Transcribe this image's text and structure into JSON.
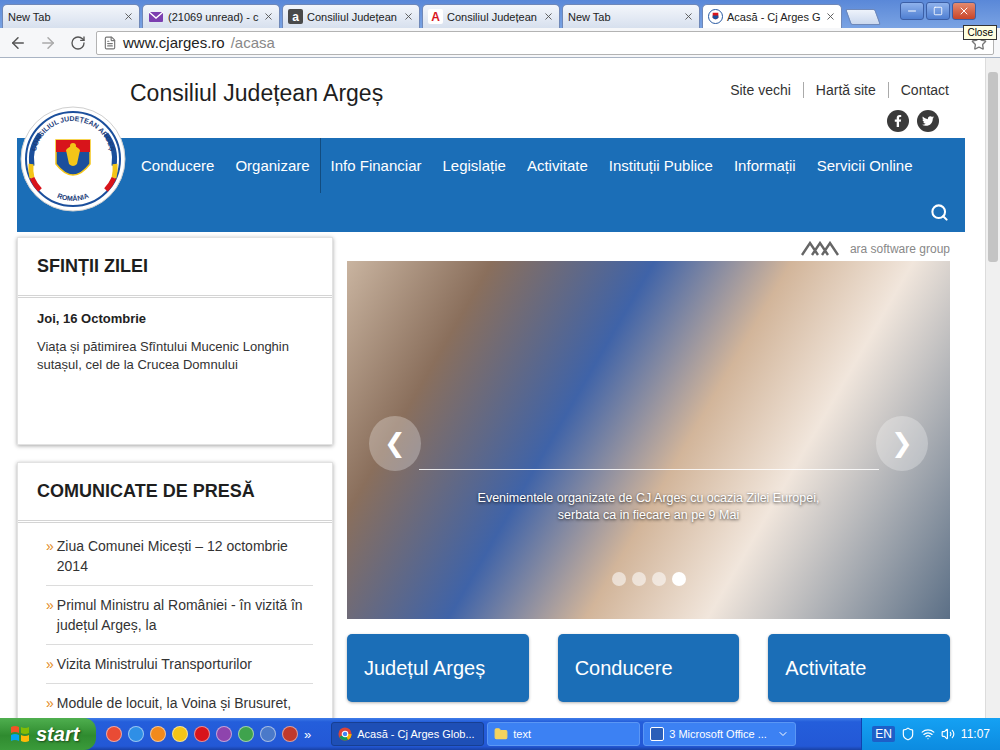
{
  "browser": {
    "tabs": [
      {
        "label": "New Tab",
        "selected": false,
        "icon": "none"
      },
      {
        "label": "(21069 unread) - c",
        "selected": false,
        "icon": "mail"
      },
      {
        "label": "Consiliul Județean",
        "selected": false,
        "icon": "letter",
        "icon_text": "a"
      },
      {
        "label": "Consiliul Județean",
        "selected": false,
        "icon": "letter-red",
        "icon_text": "A"
      },
      {
        "label": "New Tab",
        "selected": false,
        "icon": "none"
      },
      {
        "label": "Acasă - Cj Arges G",
        "selected": true,
        "icon": "crest"
      }
    ],
    "tooltip": "Close",
    "address": {
      "host": "www.cjarges.ro",
      "path": "/acasa"
    }
  },
  "site": {
    "logo": {
      "arc_top": "CONSILIUL JUDEȚEAN ARGEȘ",
      "arc_bottom": "ROMÂNIA"
    },
    "title": "Consiliul Județean Argeș",
    "top_links": [
      "Site vechi",
      "Hartă site",
      "Contact"
    ],
    "nav": [
      {
        "label": "Conducere",
        "separator_before": false
      },
      {
        "label": "Organizare",
        "separator_before": false
      },
      {
        "label": "Info Financiar",
        "separator_before": true
      },
      {
        "label": "Legislație",
        "separator_before": false
      },
      {
        "label": "Activitate",
        "separator_before": false
      },
      {
        "label": "Instituții Publice",
        "separator_before": false
      },
      {
        "label": "Informații",
        "separator_before": false
      },
      {
        "label": "Servicii Online",
        "separator_before": false
      }
    ],
    "saints": {
      "heading": "SFINȚII ZILEI",
      "date": "Joi, 16 Octombrie",
      "text": "Viața și pătimirea Sfîntului Mucenic Longhin sutașul, cel de la Crucea Domnului"
    },
    "press": {
      "heading": "COMUNICATE DE PRESĂ",
      "bullet": "»",
      "items": [
        "Ziua Comunei Micești – 12 octombrie 2014",
        "Primul Ministru al României - în vizită în județul Argeș, la",
        "Vizita Ministrului Transporturilor",
        "Module de locuit, la Voina și Brusuret,"
      ]
    },
    "vendor": "ara software group",
    "slider": {
      "caption": "Evenimentele organizate de CJ Arges cu ocazia Zilei Europei, serbata ca in fiecare an pe 9 Mai",
      "prev": "❮",
      "next": "❯",
      "dots": [
        {
          "selected": false
        },
        {
          "selected": false
        },
        {
          "selected": false
        },
        {
          "selected": true
        }
      ]
    },
    "quick_links": [
      "Județul Argeș",
      "Conducere",
      "Activitate"
    ]
  },
  "taskbar": {
    "start": "start",
    "overflow": "»",
    "tasks": [
      {
        "label": "Acasă - Cj Arges Glob...",
        "icon": "chrome",
        "selected": true,
        "grouped": false
      },
      {
        "label": "text",
        "icon": "folder",
        "selected": false,
        "grouped": false
      },
      {
        "label": "3 Microsoft Office ...",
        "icon": "word",
        "selected": false,
        "grouped": true
      }
    ],
    "language": "EN",
    "clock": "11:07"
  }
}
